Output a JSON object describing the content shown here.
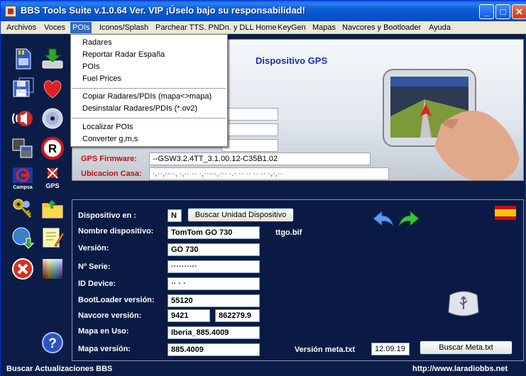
{
  "window": {
    "title": "BBS Tools Suite v.1.0.64  Ver. VIP   ¡Úselo bajo su responsabilidad!"
  },
  "titlebar_buttons": {
    "minimize": "_",
    "maximize": "□",
    "close": "✕"
  },
  "menu": {
    "items": [
      "Archivos",
      "Voces",
      "POIs",
      "Iconos/Splash",
      "Parchear TTS. PNDn. y DLL Home",
      "KeyGen",
      "Mapas",
      "Navcores y Bootloader",
      "Ayuda"
    ],
    "active_index": 2
  },
  "dropdown": {
    "items": [
      "Radares",
      "Reportar Radar España",
      "POIs",
      "Fuel Prices",
      "Copiar Radares/PDIs (mapa<>mapa)",
      "Desinstalar Radares/PDIs (*.ov2)",
      "Localizar POIs",
      "Converter g,m,s"
    ]
  },
  "left_toolbar": {
    "icons": [
      "sd-card-icon",
      "download-drive-icon",
      "floppy-icon",
      "heart-icon",
      "speaker-sound-icon",
      "cd-disc-icon",
      "copy-windows-icon",
      "radar-r-icon",
      "campsa-logo-icon",
      "gps-satellite-icon",
      "keys-icon",
      "folder-icon",
      "globe-download-icon",
      "notepad-pencil-icon",
      "close-red-icon",
      "color-palette-icon",
      "help-icon"
    ],
    "labels": {
      "campsa": "Campsa",
      "gps": "GPS"
    }
  },
  "top_panel": {
    "title": "Dispositivo GPS",
    "gps_firmware_label": "GPS Firmware:",
    "gps_firmware_value": "--GSW3.2.4TT_3.1.00.12-C35B1.02",
    "ubicacion_label": "Ubicacion Casa:",
    "ubicacion_value": "·,··,····, ·,·· ·· ·,·····,··· ·.· ·· ·· ·· ·· ·,·,··"
  },
  "device": {
    "dispositivo_en_label": "Dispositivo en :",
    "dispositivo_en_value": "N",
    "buscar_unidad_button": "Buscar Unidad Dispositivo",
    "nombre_label": "Nombre dispositivo:",
    "nombre_value": "TomTom GO 730",
    "bif_file": "ttgo.bif",
    "version_label": "Versión:",
    "version_value": "GO 730",
    "serie_label": "Nº Serie:",
    "serie_value": "··········",
    "id_label": "ID Device:",
    "id_value": "··  ·  ·",
    "bootloader_label": "BootLoader versión:",
    "bootloader_value": "55120",
    "navcore_label": "Navcore versión:",
    "navcore_value1": "9421",
    "navcore_value2": "862279.9",
    "mapa_uso_label": "Mapa en Uso:",
    "mapa_uso_value": "Iberia_885.4009",
    "mapa_version_label": "Mapa versión:",
    "mapa_version_value": "885.4009",
    "meta_label": "Versión meta.txt",
    "meta_value": "12.09.19",
    "buscar_meta_button": "Buscar Meta.txt"
  },
  "status": {
    "left": "Buscar Actualizaciones BBS",
    "right": "http://www.laradiobbs.net"
  },
  "colors": {
    "background": "#0b1d46",
    "accent_red": "#c01010",
    "title_blue": "#1b2fb8",
    "menu_highlight": "#316ac5"
  }
}
